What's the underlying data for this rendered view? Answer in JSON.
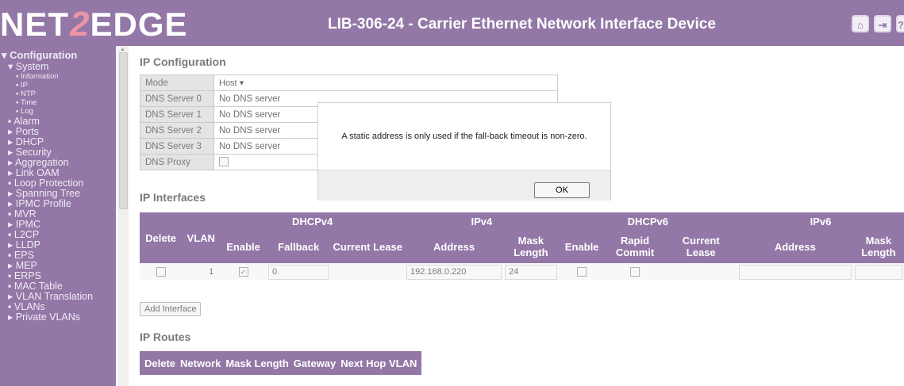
{
  "header": {
    "logo_left": "NET",
    "logo_two": "2",
    "logo_right": "EDGE",
    "title": "LIB-306-24 - Carrier Ethernet Network Interface Device",
    "icons": [
      "home-icon",
      "logout-icon",
      "help-icon"
    ]
  },
  "sidebar": {
    "items": [
      {
        "label": "▾ Configuration"
      },
      {
        "label": "▾ System"
      },
      {
        "label": "▪ Information"
      },
      {
        "label": "▪ IP"
      },
      {
        "label": "▪ NTP"
      },
      {
        "label": "▪ Time"
      },
      {
        "label": "▪ Log"
      },
      {
        "label": "▪ Alarm"
      },
      {
        "label": "▸ Ports"
      },
      {
        "label": "▸ DHCP"
      },
      {
        "label": "▸ Security"
      },
      {
        "label": "▸ Aggregation"
      },
      {
        "label": "▸ Link OAM"
      },
      {
        "label": "▪ Loop Protection"
      },
      {
        "label": "▸ Spanning Tree"
      },
      {
        "label": "▸ IPMC Profile"
      },
      {
        "label": "▪ MVR"
      },
      {
        "label": "▸ IPMC"
      },
      {
        "label": "▪ L2CP"
      },
      {
        "label": "▸ LLDP"
      },
      {
        "label": "▪ EPS"
      },
      {
        "label": "▸ MEP"
      },
      {
        "label": "▪ ERPS"
      },
      {
        "label": "▪ MAC Table"
      },
      {
        "label": "▸ VLAN Translation"
      },
      {
        "label": "▪ VLANs"
      },
      {
        "label": "▸ Private VLANs"
      }
    ]
  },
  "ip_config": {
    "title": "IP Configuration",
    "rows": [
      {
        "label": "Mode",
        "value": "Host"
      },
      {
        "label": "DNS Server 0",
        "value": "No DNS server"
      },
      {
        "label": "DNS Server 1",
        "value": "No DNS server"
      },
      {
        "label": "DNS Server 2",
        "value": "No DNS server"
      },
      {
        "label": "DNS Server 3",
        "value": "No DNS server"
      },
      {
        "label": "DNS Proxy",
        "value": ""
      }
    ]
  },
  "ip_interfaces": {
    "title": "IP Interfaces",
    "group_headers": [
      "DHCPv4",
      "IPv4",
      "DHCPv6",
      "IPv6"
    ],
    "col_delete": "Delete",
    "col_vlan": "VLAN",
    "col_enable": "Enable",
    "col_fallback": "Fallback",
    "col_current_lease": "Current Lease",
    "col_address": "Address",
    "col_mask_length": "Mask Length",
    "col_enable6": "Enable",
    "col_rapid_commit": "Rapid Commit",
    "col_current_lease6": "Current Lease",
    "col_address6": "Address",
    "col_mask_length6": "Mask Length",
    "row": {
      "vlan": "1",
      "fallback": "0",
      "address": "192.168.0.220",
      "mask": "24"
    },
    "add_button": "Add Interface"
  },
  "ip_routes": {
    "title": "IP Routes",
    "columns": [
      "Delete",
      "Network",
      "Mask Length",
      "Gateway",
      "Next Hop VLAN"
    ]
  },
  "dialog": {
    "message": "A static address is only used if the fall-back timeout is non-zero.",
    "ok_label": "OK"
  }
}
